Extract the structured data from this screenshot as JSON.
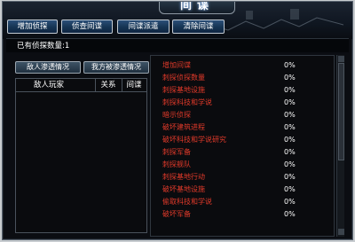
{
  "window": {
    "title": "间谍"
  },
  "toolbar": {
    "buttons": [
      {
        "label": "增加侦探"
      },
      {
        "label": "侦查间谍"
      },
      {
        "label": "间谍派遣"
      },
      {
        "label": "清除间谍"
      }
    ]
  },
  "status": {
    "spy_count": "已有侦探数量:1"
  },
  "left": {
    "tabs": [
      {
        "label": "敌人渗透情况"
      },
      {
        "label": "我方被渗透情况"
      }
    ],
    "columns": [
      "敌人玩家",
      "关系",
      "间谍"
    ],
    "rows": []
  },
  "actions": [
    {
      "name": "增加间谍",
      "pct": "0%"
    },
    {
      "name": "刺探侦探数量",
      "pct": "0%"
    },
    {
      "name": "刺探基地设施",
      "pct": "0%"
    },
    {
      "name": "刺探科技和学说",
      "pct": "0%"
    },
    {
      "name": "暗示侦探",
      "pct": "0%"
    },
    {
      "name": "破坏建筑进程",
      "pct": "0%"
    },
    {
      "name": "破坏科技和学说研究",
      "pct": "0%"
    },
    {
      "name": "刺探军备",
      "pct": "0%"
    },
    {
      "name": "刺探舰队",
      "pct": "0%"
    },
    {
      "name": "刺探基地行动",
      "pct": "0%"
    },
    {
      "name": "破坏基地设施",
      "pct": "0%"
    },
    {
      "name": "偷取科技和学说",
      "pct": "0%"
    },
    {
      "name": "破坏军备",
      "pct": "0%"
    }
  ],
  "colors": {
    "action_text": "#e23a2a",
    "button_fill": "#173656",
    "background": "#0b0d12"
  },
  "icons": [
    "scroll-up-arrow",
    "scroll-down-arrow"
  ]
}
